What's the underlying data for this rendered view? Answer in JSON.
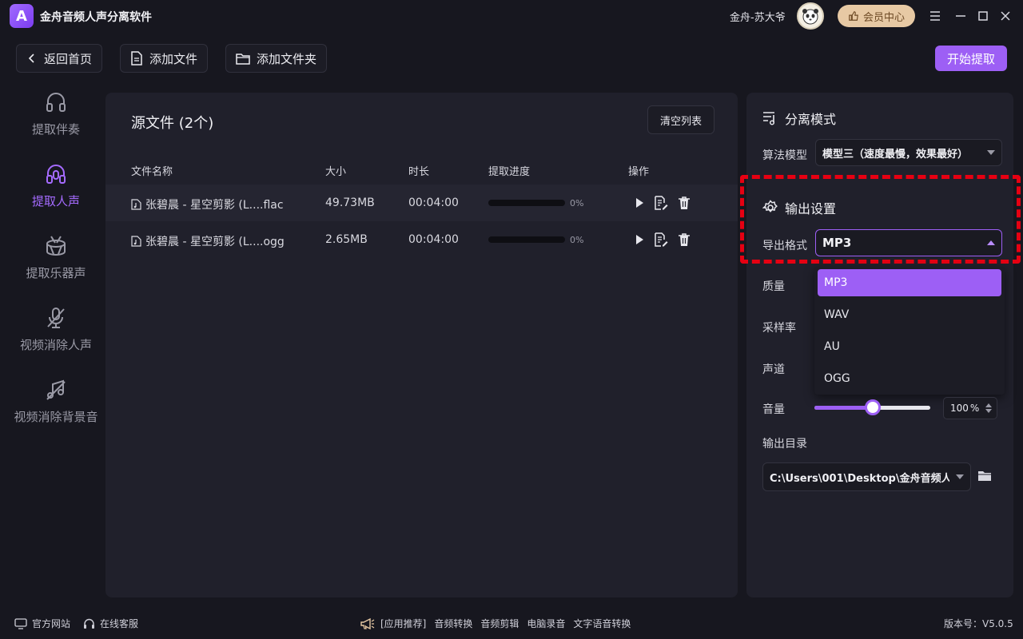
{
  "app": {
    "title": "金舟音频人声分离软件",
    "logo_letter": "A",
    "user": "金舟-苏大爷",
    "vip_label": "会员中心"
  },
  "toolbar": {
    "back": "返回首页",
    "add_file": "添加文件",
    "add_folder": "添加文件夹",
    "start": "开始提取"
  },
  "nav": [
    {
      "label": "提取伴奏",
      "icon": "headphones-icon"
    },
    {
      "label": "提取人声",
      "icon": "vocal-headphones-icon"
    },
    {
      "label": "提取乐器声",
      "icon": "drum-icon"
    },
    {
      "label": "视频消除人声",
      "icon": "mute-mic-icon"
    },
    {
      "label": "视频消除背景音",
      "icon": "mute-music-icon"
    }
  ],
  "nav_active": "提取人声",
  "source": {
    "title": "源文件 (2个)",
    "clear": "清空列表",
    "headers": {
      "name": "文件名称",
      "size": "大小",
      "duration": "时长",
      "progress": "提取进度",
      "actions": "操作"
    },
    "rows": [
      {
        "name": "张碧晨 - 星空剪影 (L....flac",
        "size": "49.73MB",
        "duration": "00:04:00",
        "progress": 0,
        "progress_label": "0%"
      },
      {
        "name": "张碧晨 - 星空剪影 (L....ogg",
        "size": "2.65MB",
        "duration": "00:04:00",
        "progress": 0,
        "progress_label": "0%"
      }
    ]
  },
  "settings": {
    "mode_title": "分离模式",
    "model_label": "算法模型",
    "model_value": "模型三（速度最慢，效果最好）",
    "output_title": "输出设置",
    "format_label": "导出格式",
    "format_value": "MP3",
    "format_options": [
      "MP3",
      "WAV",
      "AU",
      "OGG"
    ],
    "quality_label": "质量",
    "sample_rate_label": "采样率",
    "channel_label": "声道",
    "volume_label": "音量",
    "volume_value": 100,
    "volume_display": "100",
    "volume_unit": "%",
    "volume_max": 200,
    "output_dir_label": "输出目录",
    "output_dir_value": "C:\\Users\\001\\Desktop\\金舟音频人"
  },
  "footer": {
    "website": "官方网站",
    "support": "在线客服",
    "recommend_label": "[应用推荐]",
    "links": [
      "音频转换",
      "音频剪辑",
      "电脑录音",
      "文字语音转换"
    ],
    "version": "版本号：V5.0.5"
  },
  "colors": {
    "accent": "#9d5ff5",
    "highlight_border": "#e60012",
    "vip": "#e7c9a4"
  }
}
